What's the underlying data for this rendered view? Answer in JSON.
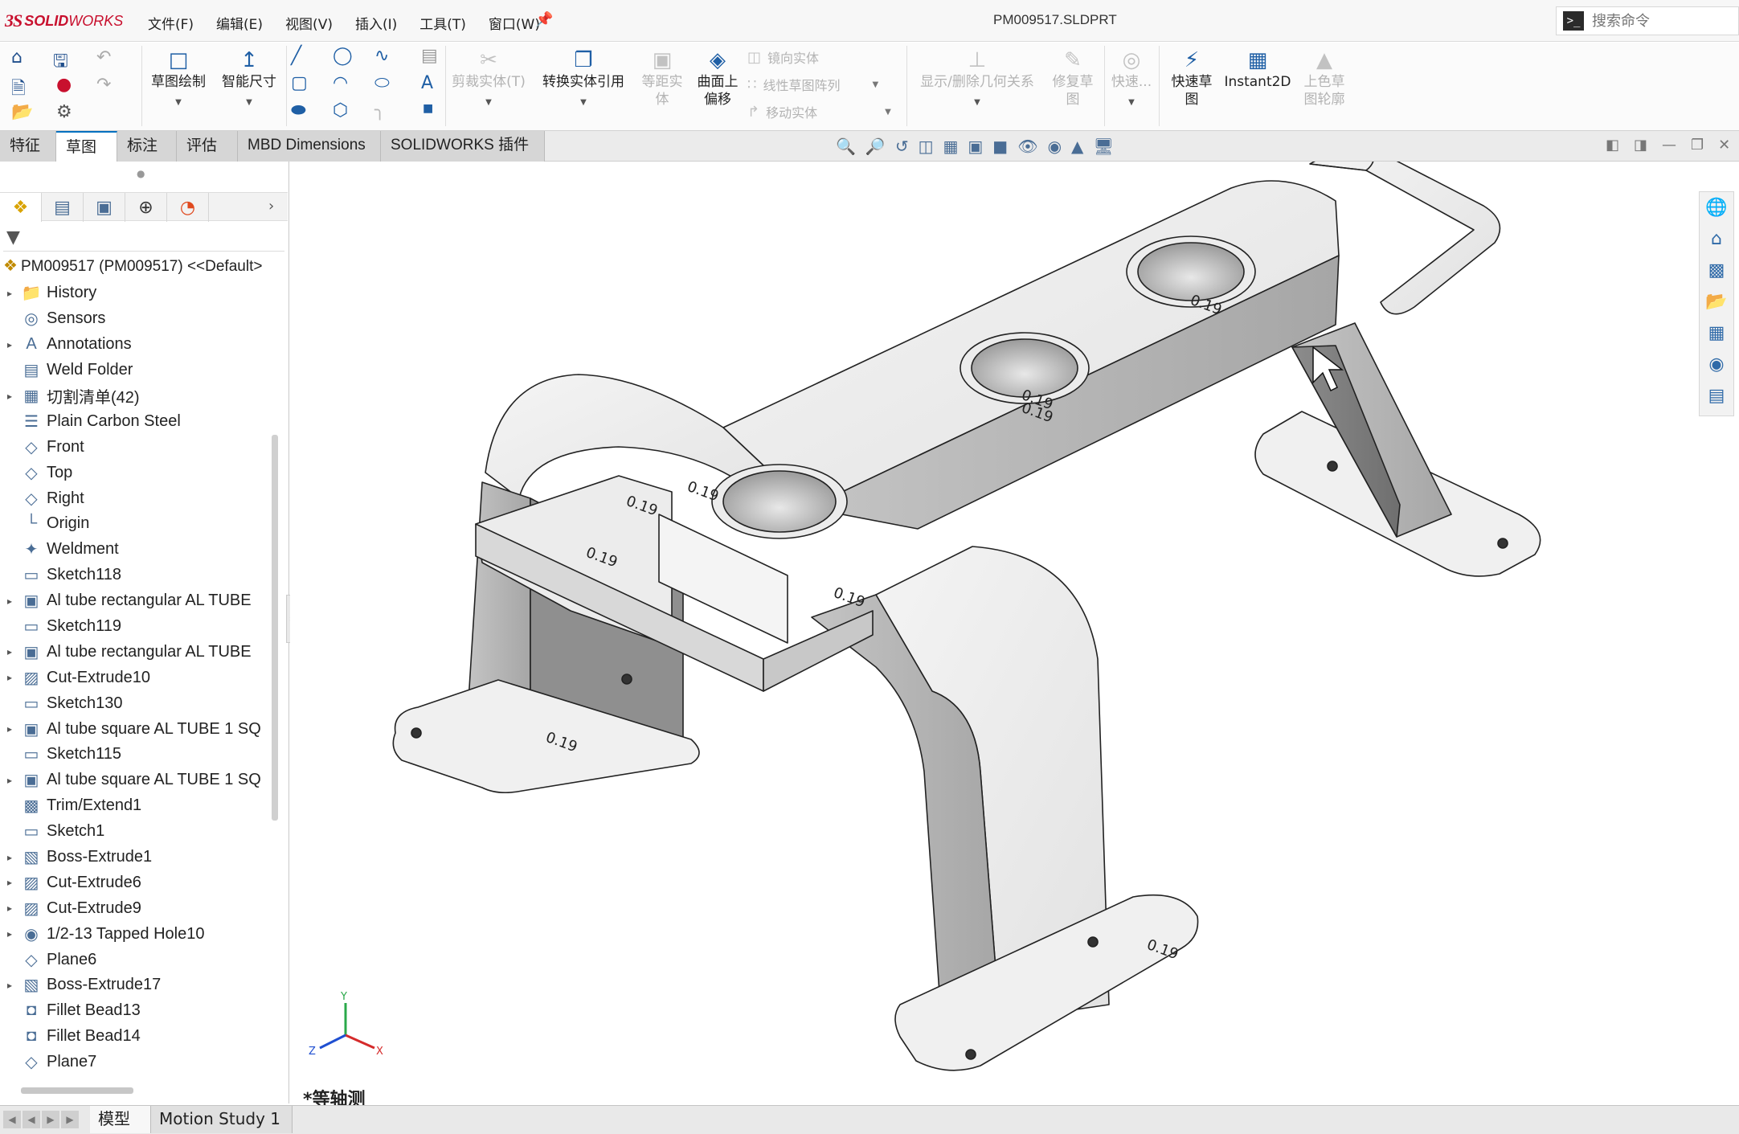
{
  "app": {
    "brand_ds": "3S",
    "brand_name_bold": "SOLID",
    "brand_name": "WORKS",
    "document_title": "PM009517.SLDPRT"
  },
  "menus": [
    "文件(F)",
    "编辑(E)",
    "视图(V)",
    "插入(I)",
    "工具(T)",
    "窗口(W)"
  ],
  "search": {
    "placeholder": "搜索命令",
    "icon": "terminal-icon"
  },
  "toolbar": {
    "sketch": "草图绘制",
    "smart_dimension": "智能尺寸",
    "trim_entities": "剪裁实体(T)",
    "convert_entities": "转换实体引用",
    "offset_entities_1": "等距实",
    "offset_entities_2": "体",
    "offset_on_surface_1": "曲面上",
    "offset_on_surface_2": "偏移",
    "mirror_entities": "镜向实体",
    "linear_pattern": "线性草图阵列",
    "move_entities": "移动实体",
    "display_relations": "显示/删除几何关系",
    "repair_sketch_1": "修复草",
    "repair_sketch_2": "图",
    "quick_snaps": "快速...",
    "rapid_sketch_1": "快速草",
    "rapid_sketch_2": "图",
    "instant2d": "Instant2D",
    "shaded_contours_1": "上色草",
    "shaded_contours_2": "图轮廓"
  },
  "command_tabs": [
    "特征",
    "草图",
    "标注",
    "评估",
    "MBD Dimensions",
    "SOLIDWORKS 插件"
  ],
  "active_command_tab": "草图",
  "feature_manager": {
    "root": "PM009517 (PM009517) <<Default>",
    "items": [
      {
        "label": "History",
        "expandable": true,
        "icon": "history-folder-icon"
      },
      {
        "label": "Sensors",
        "expandable": false,
        "icon": "sensor-icon"
      },
      {
        "label": "Annotations",
        "expandable": true,
        "icon": "annotations-icon"
      },
      {
        "label": "Weld Folder",
        "expandable": false,
        "icon": "weld-folder-icon"
      },
      {
        "label": "切割清单(42)",
        "expandable": true,
        "icon": "cut-list-icon"
      },
      {
        "label": "Plain Carbon Steel",
        "expandable": false,
        "icon": "material-icon"
      },
      {
        "label": "Front",
        "expandable": false,
        "icon": "plane-icon"
      },
      {
        "label": "Top",
        "expandable": false,
        "icon": "plane-icon"
      },
      {
        "label": "Right",
        "expandable": false,
        "icon": "plane-icon"
      },
      {
        "label": "Origin",
        "expandable": false,
        "icon": "origin-icon"
      },
      {
        "label": "Weldment",
        "expandable": false,
        "icon": "weldment-icon"
      },
      {
        "label": "Sketch118",
        "expandable": false,
        "icon": "sketch-icon"
      },
      {
        "label": "Al tube rectangular AL TUBE",
        "expandable": true,
        "icon": "structural-member-icon"
      },
      {
        "label": "Sketch119",
        "expandable": false,
        "icon": "sketch-icon"
      },
      {
        "label": "Al tube rectangular AL TUBE",
        "expandable": true,
        "icon": "structural-member-icon"
      },
      {
        "label": "Cut-Extrude10",
        "expandable": true,
        "icon": "cut-extrude-icon"
      },
      {
        "label": "Sketch130",
        "expandable": false,
        "icon": "sketch-icon"
      },
      {
        "label": "Al tube square AL TUBE 1 SQ",
        "expandable": true,
        "icon": "structural-member-icon"
      },
      {
        "label": "Sketch115",
        "expandable": false,
        "icon": "sketch-icon"
      },
      {
        "label": "Al tube square AL TUBE 1 SQ",
        "expandable": true,
        "icon": "structural-member-icon"
      },
      {
        "label": "Trim/Extend1",
        "expandable": false,
        "icon": "trim-extend-icon"
      },
      {
        "label": "Sketch1",
        "expandable": false,
        "icon": "sketch-icon"
      },
      {
        "label": "Boss-Extrude1",
        "expandable": true,
        "icon": "boss-extrude-icon"
      },
      {
        "label": "Cut-Extrude6",
        "expandable": true,
        "icon": "cut-extrude-icon"
      },
      {
        "label": "Cut-Extrude9",
        "expandable": true,
        "icon": "cut-extrude-icon"
      },
      {
        "label": "1/2-13 Tapped Hole10",
        "expandable": true,
        "icon": "hole-wizard-icon"
      },
      {
        "label": "Plane6",
        "expandable": false,
        "icon": "plane-icon"
      },
      {
        "label": "Boss-Extrude17",
        "expandable": true,
        "icon": "boss-extrude-icon"
      },
      {
        "label": "Fillet Bead13",
        "expandable": false,
        "icon": "fillet-bead-icon"
      },
      {
        "label": "Fillet Bead14",
        "expandable": false,
        "icon": "fillet-bead-icon"
      },
      {
        "label": "Plane7",
        "expandable": false,
        "icon": "plane-icon"
      }
    ]
  },
  "viewport": {
    "view_orientation": "*等轴测",
    "weld_size_labels": [
      "0.19",
      "0.19",
      "0.19",
      "0.19",
      "0.19",
      "0.19",
      "0.19",
      "0.19",
      "0.19"
    ],
    "triad": {
      "x": "X",
      "y": "Y",
      "z": "Z"
    }
  },
  "bottom_tabs": [
    "模型",
    "Motion Study 1"
  ],
  "active_bottom_tab": "模型"
}
